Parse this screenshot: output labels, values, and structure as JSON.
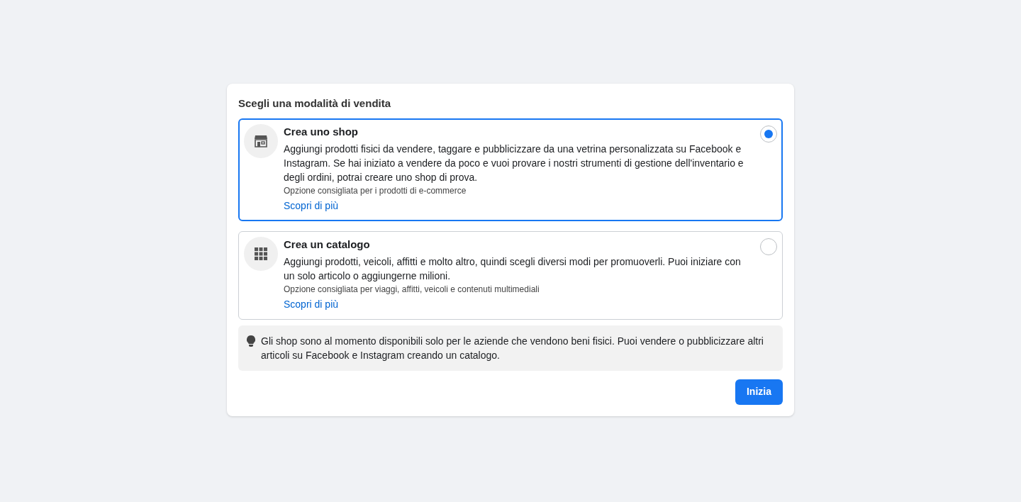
{
  "dialog": {
    "title": "Scegli una modalità di vendita",
    "options": [
      {
        "kind": "shop",
        "title": "Crea uno shop",
        "description": "Aggiungi prodotti fisici da vendere, taggare e pubblicizzare da una vetrina personalizzata su Facebook e Instagram. Se hai iniziato a vendere da poco e vuoi provare i nostri strumenti di gestione dell'inventario e degli ordini, potrai creare uno shop di prova.",
        "note": "Opzione consigliata per i prodotti di e-commerce",
        "link": "Scopri di più",
        "selected": true
      },
      {
        "kind": "catalog",
        "title": "Crea un catalogo",
        "description": "Aggiungi prodotti, veicoli, affitti e molto altro, quindi scegli diversi modi per promuoverli. Puoi iniziare con un solo articolo o aggiungerne milioni.",
        "note": "Opzione consigliata per viaggi, affitti, veicoli e contenuti multimediali",
        "link": "Scopri di più",
        "selected": false
      }
    ],
    "tip": "Gli shop sono al momento disponibili solo per le aziende che vendono beni fisici. Puoi vendere o pubblicizzare altri articoli su Facebook e Instagram creando un catalogo.",
    "button": "Inizia"
  }
}
